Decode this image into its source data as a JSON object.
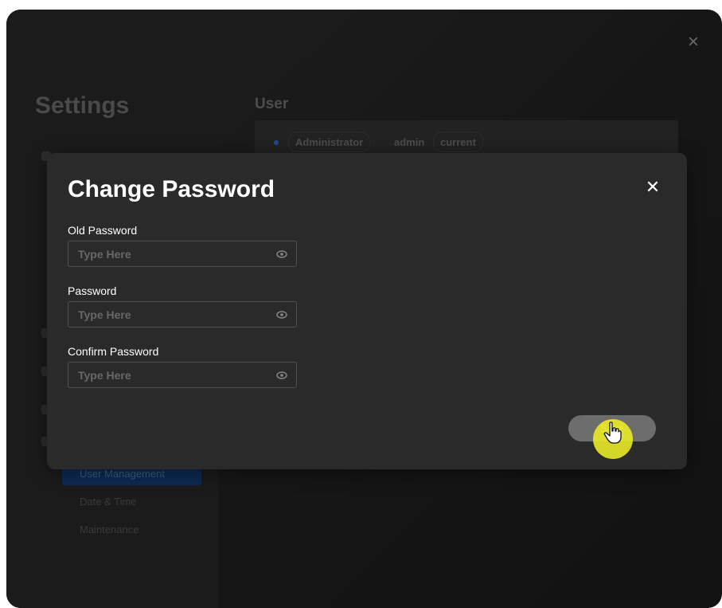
{
  "window": {
    "close_icon": "×"
  },
  "sidebar": {
    "title": "Settings",
    "items": [
      {
        "label": "User Management",
        "active": true
      },
      {
        "label": "Date & Time",
        "active": false
      },
      {
        "label": "Maintenance",
        "active": false
      }
    ]
  },
  "user_section": {
    "title": "User",
    "role": "Administrator",
    "username": "admin",
    "badge": "current"
  },
  "modal": {
    "title": "Change Password",
    "close_icon": "✕",
    "fields": [
      {
        "label": "Old Password",
        "placeholder": "Type Here",
        "icon": "eye-icon"
      },
      {
        "label": "Password",
        "placeholder": "Type Here",
        "icon": "eye-icon"
      },
      {
        "label": "Confirm Password",
        "placeholder": "Type Here",
        "icon": "eye-icon"
      }
    ],
    "save_label": "Save"
  },
  "colors": {
    "modal_background": "#2a2a2a",
    "save_button": "#6d6d6d",
    "active_item": "#0d2a52",
    "cursor_highlight": "#eeee28"
  }
}
